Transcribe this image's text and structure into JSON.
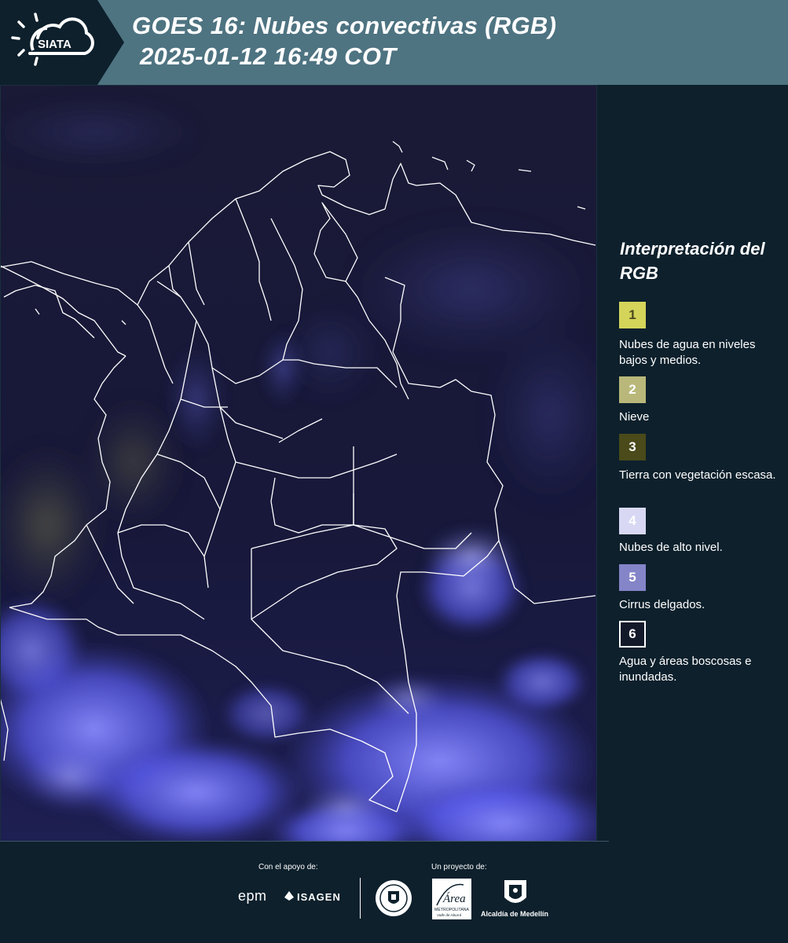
{
  "header": {
    "brand": "SIATA",
    "title_line1": "GOES 16: Nubes convectivas (RGB)",
    "title_line2": "2025-01-12 16:49 COT",
    "bar_color": "#4e7381",
    "dark_color": "#0d202c"
  },
  "map": {
    "product": "Nubes convectivas (RGB)",
    "background_color": "#161838",
    "cloud_color": "#5a5cf0",
    "border_color": "#ffffff"
  },
  "legend": {
    "title": "Interpretación del RGB",
    "items": [
      {
        "number": "1",
        "label": "Nubes de agua en niveles bajos y medios.",
        "color": "#d4d45a",
        "text_color": "#4a4a1e"
      },
      {
        "number": "2",
        "label": "Nieve",
        "color": "#b9b87a",
        "text_color": "#ffffff"
      },
      {
        "number": "3",
        "label": "Tierra con vegetación escasa.",
        "color": "#4a4a1a",
        "text_color": "#ffffff"
      },
      {
        "number": "4",
        "label": "Nubes de alto nivel.",
        "color": "#d8d8f4",
        "text_color": "#ffffff"
      },
      {
        "number": "5",
        "label": "Cirrus delgados.",
        "color": "#8484c8",
        "text_color": "#ffffff"
      },
      {
        "number": "6",
        "label": "Agua y áreas boscosas e inundadas.",
        "color": "#121a2a",
        "text_color": "#ffffff",
        "border": "#ffffff"
      }
    ]
  },
  "footer": {
    "support_label": "Con el apoyo de:",
    "project_label": "Un proyecto de:",
    "sponsors": [
      "epm",
      "ISAGEN"
    ],
    "partners": [
      "Alcaldía de Medellín",
      "Área Metropolitana Valle de Aburrá",
      "Alcaldía de Medellín"
    ],
    "alcaldia_text": "Alcaldía de Medellín",
    "area_text": "Área",
    "area_subtext": "METROPOLITANA",
    "area_subtext2": "Valle de Aburrá"
  }
}
